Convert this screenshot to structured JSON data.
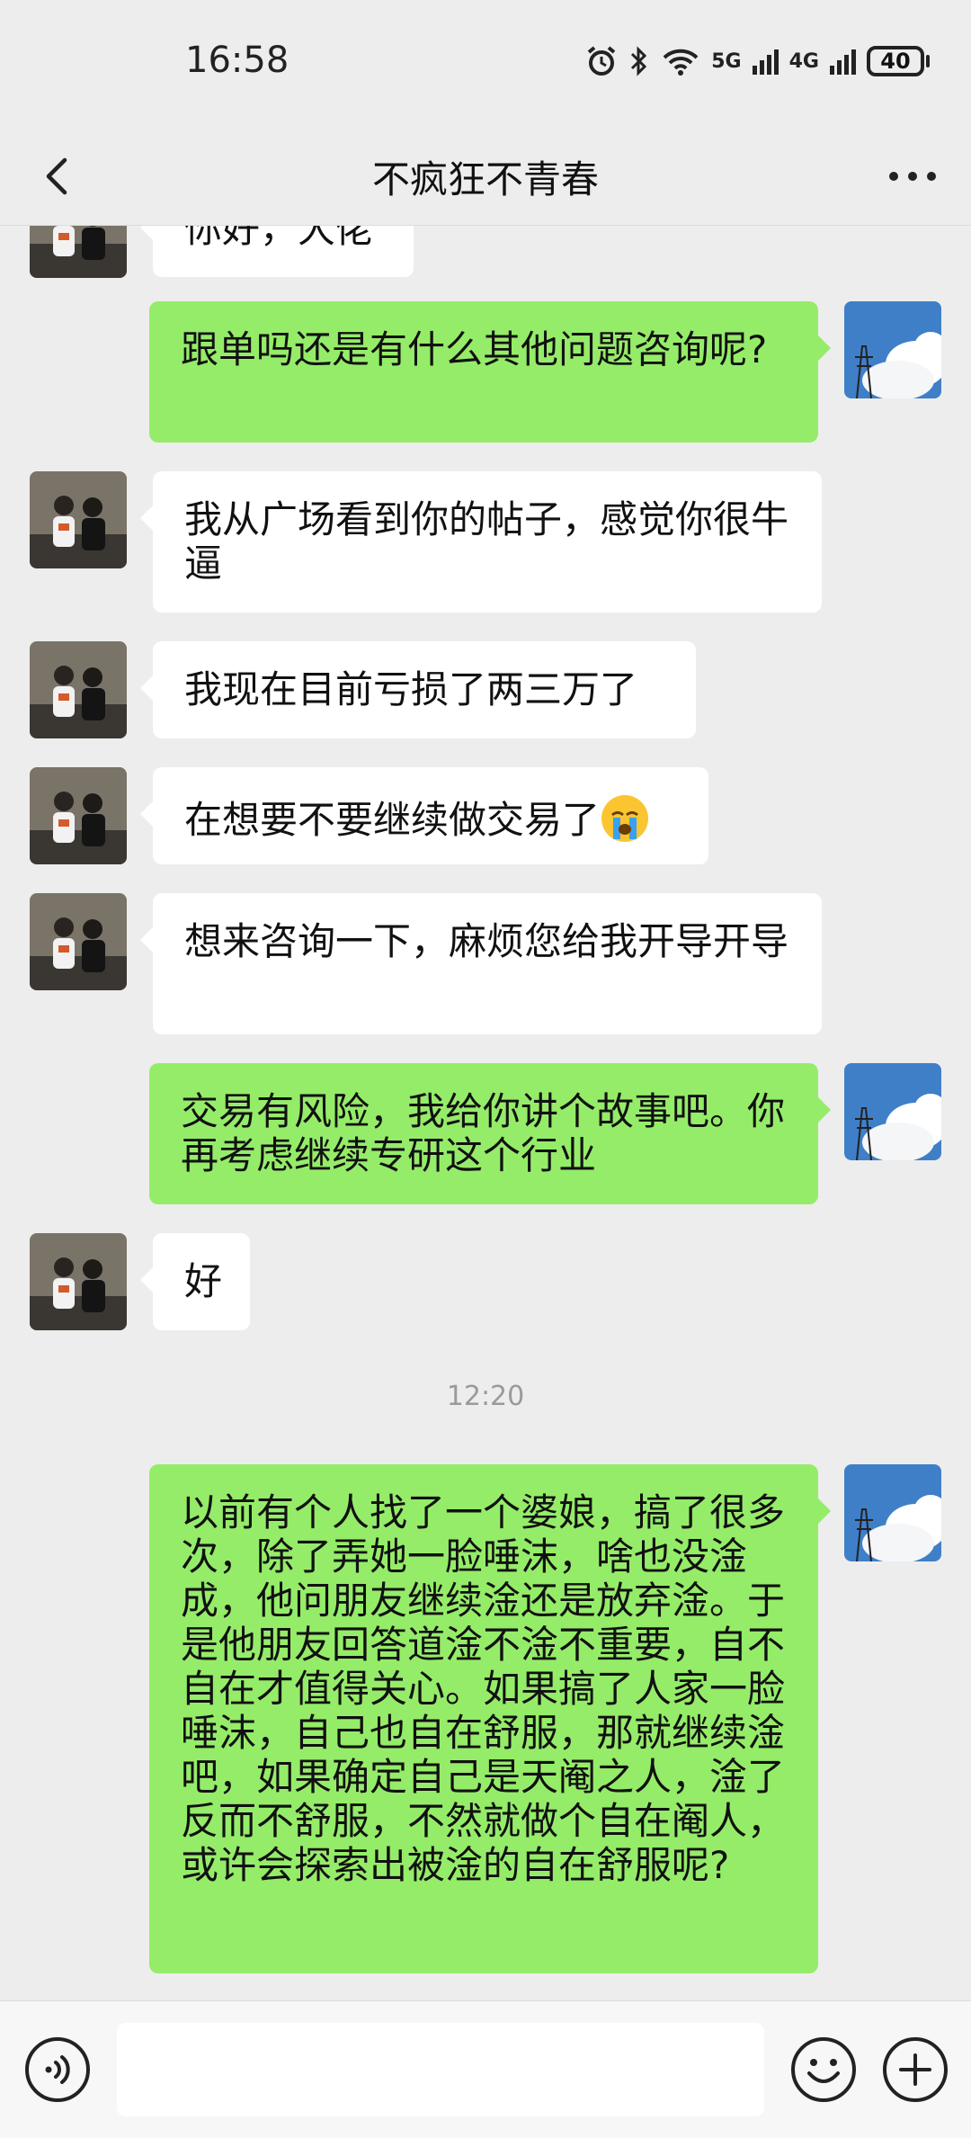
{
  "status_bar": {
    "time": "16:58",
    "net_5g": "5G",
    "net_4g": "4G",
    "battery": "40"
  },
  "header": {
    "title": "不疯狂不青春"
  },
  "messages": [
    {
      "side": "left",
      "text": "你好，大佬"
    },
    {
      "side": "right",
      "text": "跟单吗还是有什么其他问题咨询呢?"
    },
    {
      "side": "left",
      "text": "我从广场看到你的帖子，感觉你很牛逼"
    },
    {
      "side": "left",
      "text": "我现在目前亏损了两三万了"
    },
    {
      "side": "left",
      "text": "在想要不要继续做交易了"
    },
    {
      "side": "left",
      "text": "想来咨询一下，麻烦您给我开导开导"
    },
    {
      "side": "right",
      "text": "交易有风险，我给你讲个故事吧。你再考虑继续专研这个行业"
    },
    {
      "side": "left",
      "text": "好"
    },
    {
      "side": "right",
      "text": "以前有个人找了一个婆娘，搞了很多次，除了弄她一脸唾沫，啥也没淦成，他问朋友继续淦还是放弃淦。于是他朋友回答道淦不淦不重要，自不自在才值得关心。如果搞了人家一脸唾沫，自己也自在舒服，那就继续淦吧，如果确定自己是天阉之人，淦了反而不舒服，不然就做个自在阉人，或许会探索出被淦的自在舒服呢?"
    }
  ],
  "timestamp": "12:20",
  "icons": {
    "back": "chevron-left-icon",
    "more": "more-dots-icon",
    "voice": "voice-icon",
    "emoji": "emoji-icon",
    "plus": "plus-icon",
    "crying": "crying-emoji-icon"
  },
  "colors": {
    "sent_bubble": "#95ec69",
    "received_bubble": "#ffffff",
    "background": "#ededed"
  }
}
